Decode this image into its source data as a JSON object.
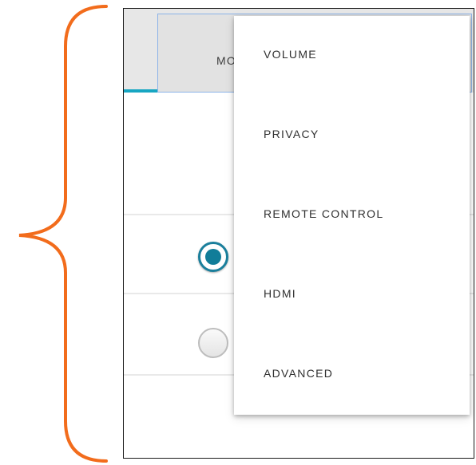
{
  "tabbar": {
    "more_label": "MORE"
  },
  "dropdown_menu": {
    "items": [
      {
        "label": "VOLUME"
      },
      {
        "label": "PRIVACY"
      },
      {
        "label": "REMOTE CONTROL"
      },
      {
        "label": "HDMI"
      },
      {
        "label": "ADVANCED"
      }
    ]
  },
  "radio_options": [
    {
      "selected": true
    },
    {
      "selected": false
    }
  ],
  "colors": {
    "annotation_brace": "#f26c1c",
    "tab_underline": "#17a6c2",
    "radio_selected": "#117d99",
    "tab_focus_border": "#8cb3e8"
  },
  "icons": {
    "annotation": "curly-brace-annotation"
  }
}
